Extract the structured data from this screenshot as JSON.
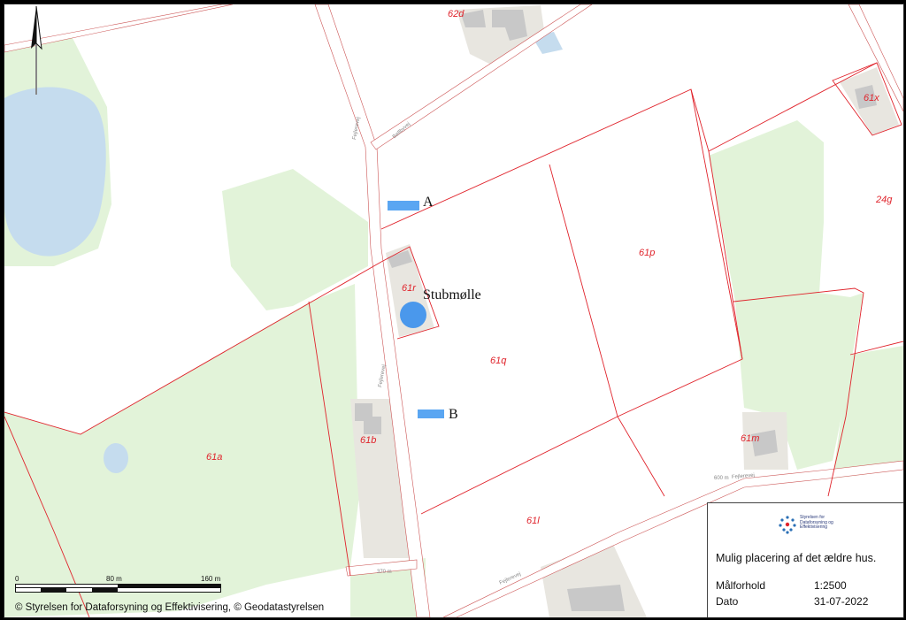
{
  "map": {
    "parcels": [
      "62d",
      "61x",
      "24g",
      "61p",
      "61r",
      "61q",
      "61b",
      "61a",
      "61m",
      "61l"
    ],
    "roads": [
      "Fejlerevej",
      "Bøllbyvej",
      "Fejlerevej",
      "Fejlerevej",
      "Fejlerevej"
    ],
    "road_distances": [
      "600 m",
      "370 m"
    ],
    "colors": {
      "boundary": "#e0232b",
      "field": "#e2f3d9",
      "water": "#c5dcee",
      "building": "#c8c8c8",
      "marker": "#5aa6f2"
    }
  },
  "markers": {
    "a_label": "A",
    "b_label": "B",
    "mill_label": "Stubmølle"
  },
  "scalebar": {
    "ticks": [
      "0",
      "80 m",
      "160 m"
    ]
  },
  "legend": {
    "logo_line1": "Styrelsen for",
    "logo_line2": "Dataforsyning og",
    "logo_line3": "Effektivisering",
    "title": "Mulig placering af det ældre hus.",
    "scale_label": "Målforhold",
    "scale_value": "1:2500",
    "date_label": "Dato",
    "date_value": "31-07-2022"
  },
  "footer": {
    "copyright": "© Styrelsen for Dataforsyning og Effektivisering, © Geodatastyrelsen"
  }
}
